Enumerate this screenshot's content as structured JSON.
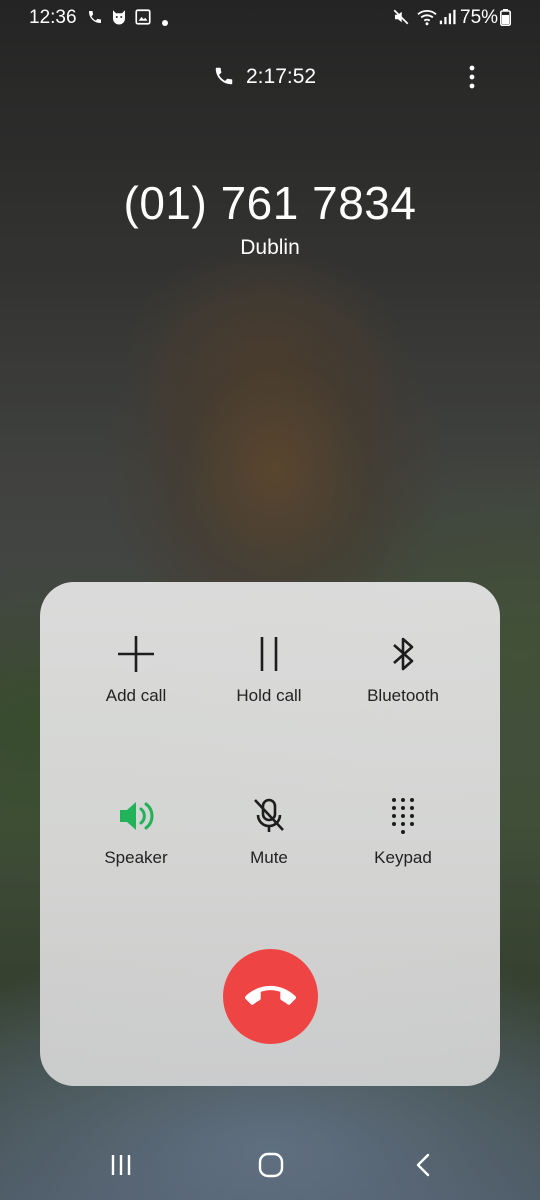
{
  "status_bar": {
    "time": "12:36",
    "battery_percent": "75%",
    "icons": [
      "phone-icon",
      "cat-notification-icon",
      "gallery-icon",
      "dot-icon",
      "mute-icon",
      "wifi-icon",
      "signal-icon",
      "battery-icon"
    ]
  },
  "call": {
    "duration": "2:17:52",
    "number": "(01) 761 7834",
    "location": "Dublin"
  },
  "controls": {
    "add_call": "Add call",
    "hold_call": "Hold call",
    "bluetooth": "Bluetooth",
    "speaker": "Speaker",
    "mute": "Mute",
    "keypad": "Keypad"
  },
  "colors": {
    "speaker_active": "#22b35a",
    "end_call": "#ef4444"
  }
}
